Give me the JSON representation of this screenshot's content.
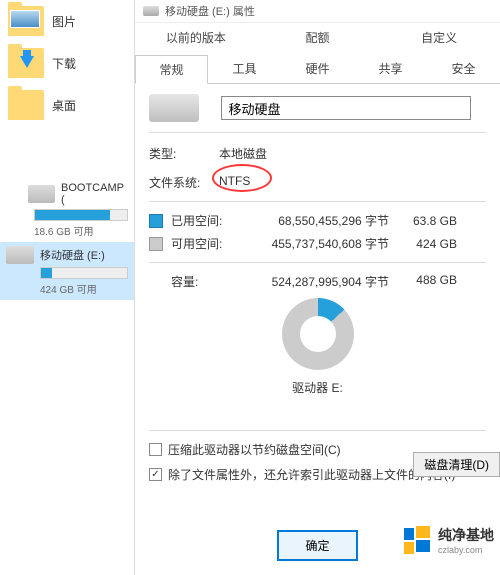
{
  "sidebar": {
    "folders": [
      {
        "label": "图片",
        "overlay": "img"
      },
      {
        "label": "下载",
        "overlay": "down"
      },
      {
        "label": "桌面",
        "overlay": ""
      }
    ],
    "drives": [
      {
        "name": "BOOTCAMP (",
        "sub": "18.6 GB 可用",
        "fill": 82,
        "selected": false,
        "win": true
      },
      {
        "name": "移动硬盘 (E:)",
        "sub": "424 GB 可用",
        "fill": 13,
        "selected": true,
        "win": false
      }
    ]
  },
  "dialog": {
    "title": "移动硬盘 (E:) 属性",
    "tabs_row1": [
      "以前的版本",
      "配额",
      "自定义"
    ],
    "tabs_row2": [
      "常规",
      "工具",
      "硬件",
      "共享",
      "安全"
    ],
    "active_tab": "常规",
    "name_value": "移动硬盘",
    "type_label": "类型:",
    "type_value": "本地磁盘",
    "fs_label": "文件系统:",
    "fs_value": "NTFS",
    "used_label": "已用空间:",
    "used_bytes": "68,550,455,296 字节",
    "used_human": "63.8 GB",
    "free_label": "可用空间:",
    "free_bytes": "455,737,540,608 字节",
    "free_human": "424 GB",
    "capacity_label": "容量:",
    "capacity_bytes": "524,287,995,904 字节",
    "capacity_human": "488 GB",
    "drive_letter_label": "驱动器 E:",
    "cleanup_btn": "磁盘清理(D)",
    "chk1": "压缩此驱动器以节约磁盘空间(C)",
    "chk2": "除了文件属性外，还允许索引此驱动器上文件的内容(I)",
    "ok": "确定"
  },
  "watermark": {
    "text": "纯净基地",
    "sub": "czlaby.com"
  },
  "chart_data": {
    "type": "pie",
    "title": "驱动器 E:",
    "series": [
      {
        "name": "已用空间",
        "value": 68550455296,
        "human": "63.8 GB",
        "color": "#26a0da"
      },
      {
        "name": "可用空间",
        "value": 455737540608,
        "human": "424 GB",
        "color": "#cccccc"
      }
    ],
    "total": {
      "value": 524287995904,
      "human": "488 GB"
    }
  }
}
